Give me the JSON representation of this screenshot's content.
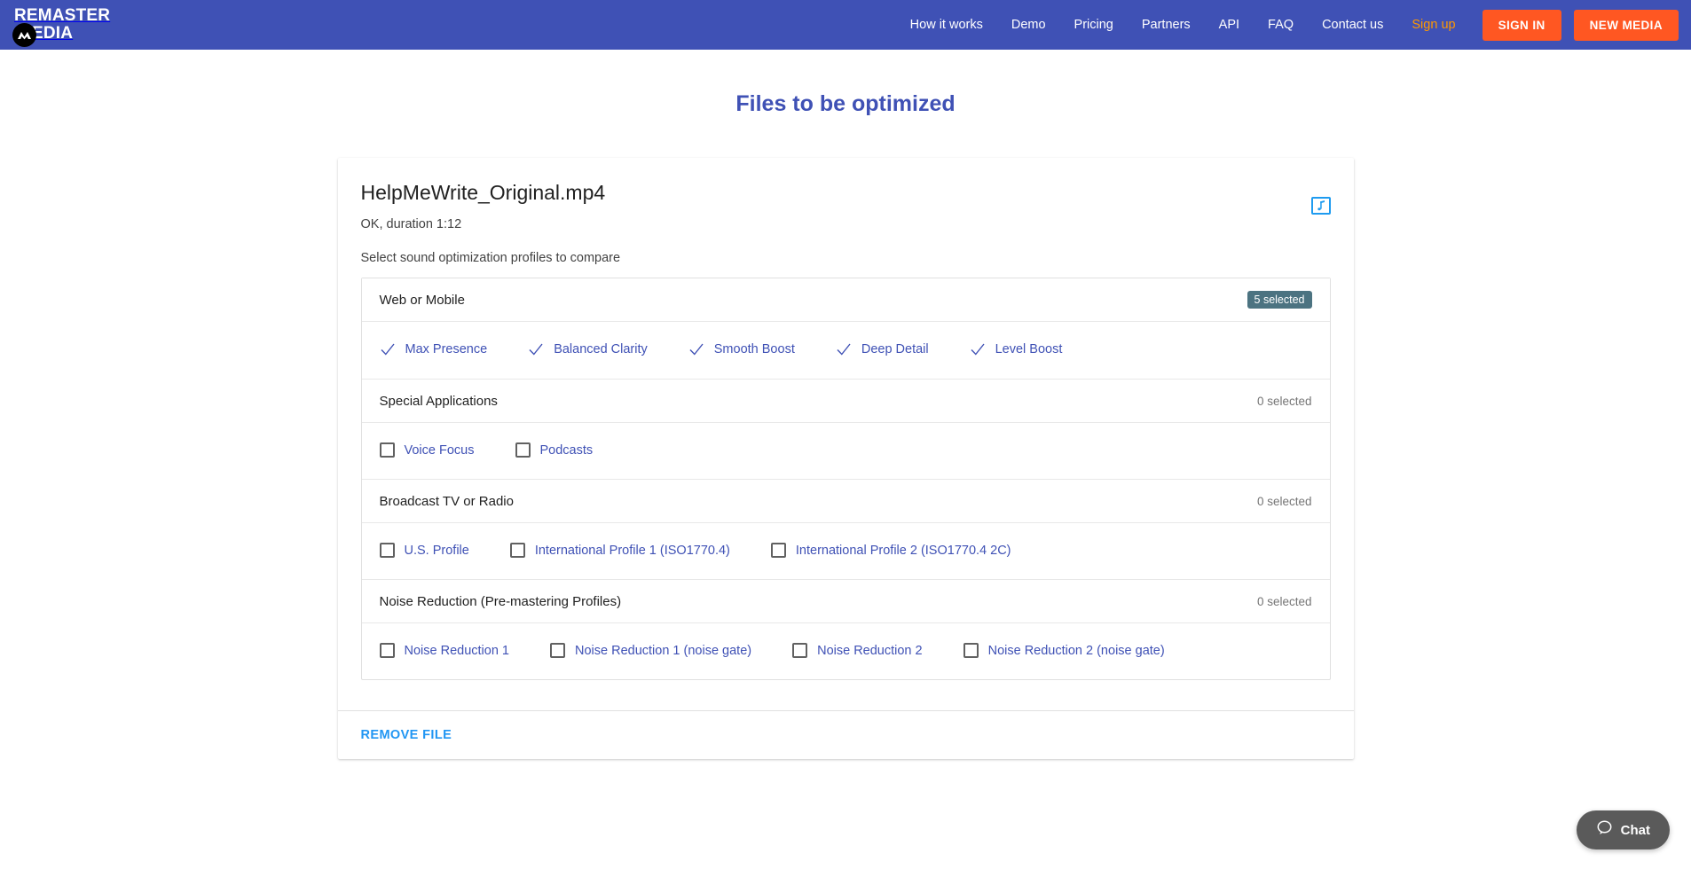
{
  "header": {
    "brand_line1": "REMASTER",
    "brand_line2": "EDIA",
    "nav_items": [
      {
        "label": "How it works",
        "accent": false
      },
      {
        "label": "Demo",
        "accent": false
      },
      {
        "label": "Pricing",
        "accent": false
      },
      {
        "label": "Partners",
        "accent": false
      },
      {
        "label": "API",
        "accent": false
      },
      {
        "label": "FAQ",
        "accent": false
      },
      {
        "label": "Contact us",
        "accent": false
      },
      {
        "label": "Sign up",
        "accent": true
      }
    ],
    "sign_in_label": "SIGN IN",
    "new_media_label": "NEW MEDIA",
    "nav_bg": "#3f51b5",
    "button_bg": "#ff5722",
    "accent_color": "#ff9800"
  },
  "page": {
    "title": "Files to be optimized",
    "title_color": "#3f51b5"
  },
  "file": {
    "name": "HelpMeWrite_Original.mp4",
    "status": "OK, duration 1:12",
    "hint": "Select sound optimization profiles to compare",
    "media_icon": "music-note-icon",
    "remove_label": "REMOVE FILE",
    "remove_color": "#2196f3"
  },
  "groups": [
    {
      "title": "Web or Mobile",
      "count_label": "5 selected",
      "count_is_badge": true,
      "badge_color": "#4c7381",
      "options": [
        {
          "label": "Max Presence",
          "checked": true
        },
        {
          "label": "Balanced Clarity",
          "checked": true
        },
        {
          "label": "Smooth Boost",
          "checked": true
        },
        {
          "label": "Deep Detail",
          "checked": true
        },
        {
          "label": "Level Boost",
          "checked": true
        }
      ]
    },
    {
      "title": "Special Applications",
      "count_label": "0 selected",
      "count_is_badge": false,
      "options": [
        {
          "label": "Voice Focus",
          "checked": false
        },
        {
          "label": "Podcasts",
          "checked": false
        }
      ]
    },
    {
      "title": "Broadcast TV or Radio",
      "count_label": "0 selected",
      "count_is_badge": false,
      "options": [
        {
          "label": "U.S. Profile",
          "checked": false
        },
        {
          "label": "International Profile 1 (ISO1770.4)",
          "checked": false
        },
        {
          "label": "International Profile 2 (ISO1770.4 2C)",
          "checked": false
        }
      ]
    },
    {
      "title": "Noise Reduction (Pre-mastering Profiles)",
      "count_label": "0 selected",
      "count_is_badge": false,
      "options": [
        {
          "label": "Noise Reduction 1",
          "checked": false
        },
        {
          "label": "Noise Reduction 1 (noise gate)",
          "checked": false
        },
        {
          "label": "Noise Reduction 2",
          "checked": false
        },
        {
          "label": "Noise Reduction 2 (noise gate)",
          "checked": false
        }
      ]
    }
  ],
  "chat": {
    "label": "Chat",
    "icon": "speech-bubble-icon"
  }
}
